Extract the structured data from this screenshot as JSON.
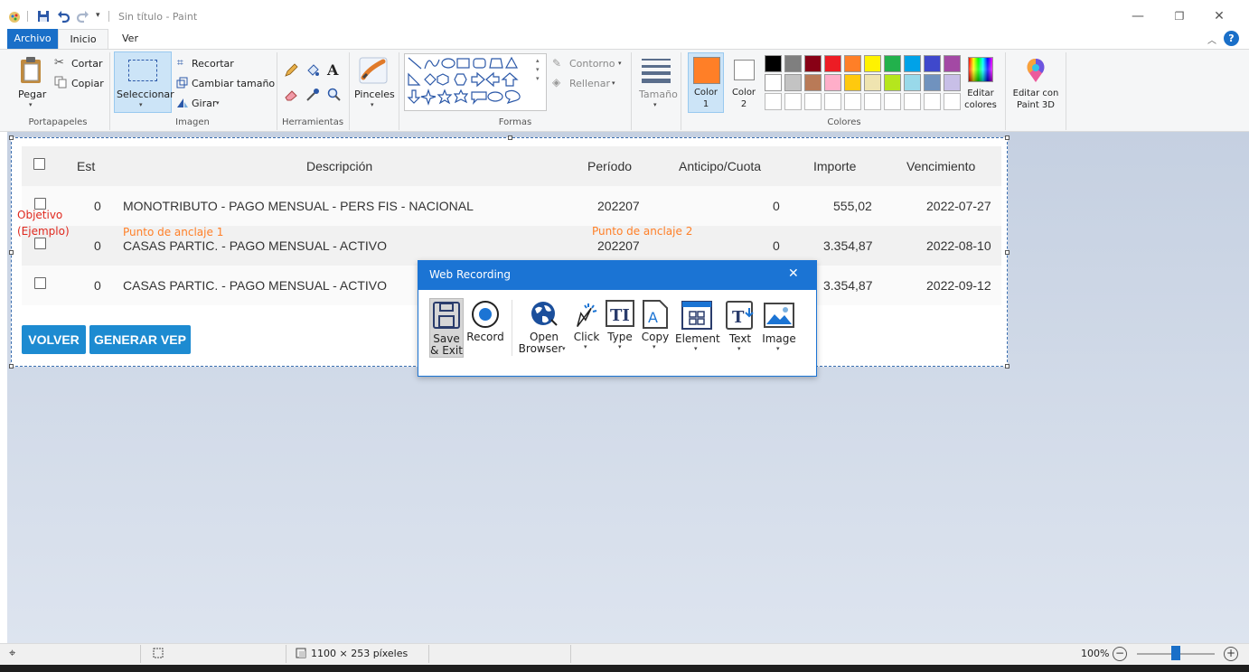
{
  "window": {
    "title": "Sin título - Paint",
    "min": "—",
    "max": "❐",
    "close": "✕"
  },
  "tabs": [
    {
      "label": "Archivo"
    },
    {
      "label": "Inicio"
    },
    {
      "label": "Ver"
    }
  ],
  "ribbon": {
    "clipboard": {
      "paste": "Pegar",
      "cut": "Cortar",
      "copy": "Copiar",
      "label": "Portapapeles"
    },
    "image": {
      "select": "Seleccionar",
      "crop": "Recortar",
      "resize": "Cambiar tamaño",
      "rotate": "Girar",
      "label": "Imagen"
    },
    "tools": {
      "label": "Herramientas"
    },
    "brushes": {
      "label": "Pinceles"
    },
    "shapes": {
      "outline": "Contorno",
      "fill": "Rellenar",
      "label": "Formas"
    },
    "size": {
      "label": "Tamaño"
    },
    "colors": {
      "color1": "Color",
      "color1_num": "1",
      "color2": "Color",
      "color2_num": "2",
      "edit": "Editar",
      "edit2": "colores",
      "label": "Colores",
      "color1_value": "#ff7f27",
      "row1": [
        "#000000",
        "#7f7f7f",
        "#880015",
        "#ed1c24",
        "#ff7f27",
        "#fff200",
        "#22b14c",
        "#00a2e8",
        "#3f48cc",
        "#a349a4"
      ],
      "row2": [
        "#ffffff",
        "#c3c3c3",
        "#b97a57",
        "#ffaec9",
        "#ffc90e",
        "#efe4b0",
        "#b5e61d",
        "#99d9ea",
        "#7092be",
        "#c8bfe7"
      ]
    },
    "paint3d": {
      "line1": "Editar con",
      "line2": "Paint 3D"
    }
  },
  "table": {
    "headers": {
      "est": "Est",
      "desc": "Descripción",
      "period": "Período",
      "advance": "Anticipo/Cuota",
      "amount": "Importe",
      "due": "Vencimiento"
    },
    "rows": [
      {
        "est": "0",
        "desc": "MONOTRIBUTO - PAGO MENSUAL - PERS FIS - NACIONAL",
        "period": "202207",
        "advance": "0",
        "amount": "555,02",
        "due": "2022-07-27"
      },
      {
        "est": "0",
        "desc": "CASAS PARTIC. - PAGO MENSUAL - ACTIVO",
        "period": "202207",
        "advance": "0",
        "amount": "3.354,87",
        "due": "2022-08-10"
      },
      {
        "est": "0",
        "desc": "CASAS PARTIC. - PAGO MENSUAL - ACTIVO",
        "period": "",
        "advance": "",
        "amount": "3.354,87",
        "due": "2022-09-12"
      }
    ],
    "back_button": "VOLVER",
    "generate_button": "GENERAR VEP"
  },
  "annotations": {
    "target1": "Objetivo",
    "target2": "(Ejemplo)",
    "anchor1": "Punto de anclaje 1",
    "anchor2": "Punto de anclaje 2"
  },
  "web_recording": {
    "title": "Web Recording",
    "close": "✕",
    "save": "Save",
    "save2": "& Exit",
    "record": "Record",
    "open": "Open",
    "open2": "Browser",
    "click": "Click",
    "type": "Type",
    "copy": "Copy",
    "element": "Element",
    "text": "Text",
    "image": "Image"
  },
  "status": {
    "dimensions": "1100 × 253 píxeles",
    "zoom": "100%",
    "zoom_level": 0.5
  }
}
